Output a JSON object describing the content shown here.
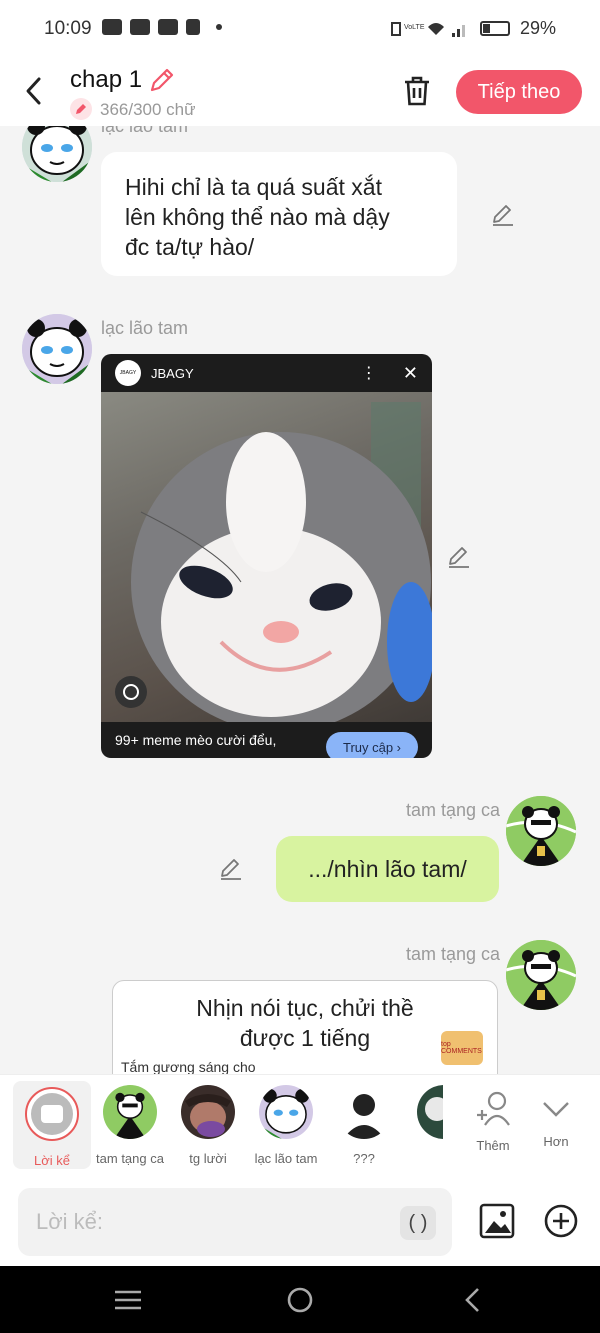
{
  "status": {
    "time": "10:09",
    "battery": "29%",
    "battery_level": 0.29
  },
  "header": {
    "title": "chap 1",
    "count": "366/300 chữ",
    "next_label": "Tiếp theo"
  },
  "messages": [
    {
      "side": "left",
      "name": "lạc lão tam",
      "text": "Hihi chỉ là ta quá suất xắt\nlên không thể nào mà dậy\nđc ta/tự hào/"
    },
    {
      "side": "left",
      "name": "lạc lão tam",
      "image": {
        "source": "JBAGY",
        "caption": "99+ meme mèo cười đểu,",
        "action": "Truy cập ›"
      }
    },
    {
      "side": "right",
      "name": "tam tạng ca",
      "text": ".../nhìn lão tam/"
    },
    {
      "side": "right",
      "name": "tam tạng ca",
      "image_text": "Nhịn nói tục, chửi thề\nđược 1 tiếng",
      "image_sub": "Tắm gương sáng cho",
      "image_logo": "top COMMENTS"
    }
  ],
  "characters": [
    {
      "label": "Lời kể"
    },
    {
      "label": "tam tạng ca"
    },
    {
      "label": "tg lười"
    },
    {
      "label": "lạc lão tam"
    },
    {
      "label": "???"
    },
    {
      "label": ""
    }
  ],
  "actions": {
    "add_label": "Thêm",
    "more_label": "Hơn"
  },
  "input": {
    "placeholder": "Lời kể:",
    "paren": "( )"
  },
  "colors": {
    "accent": "#f2566a",
    "right_bubble": "#d8f3a0"
  }
}
